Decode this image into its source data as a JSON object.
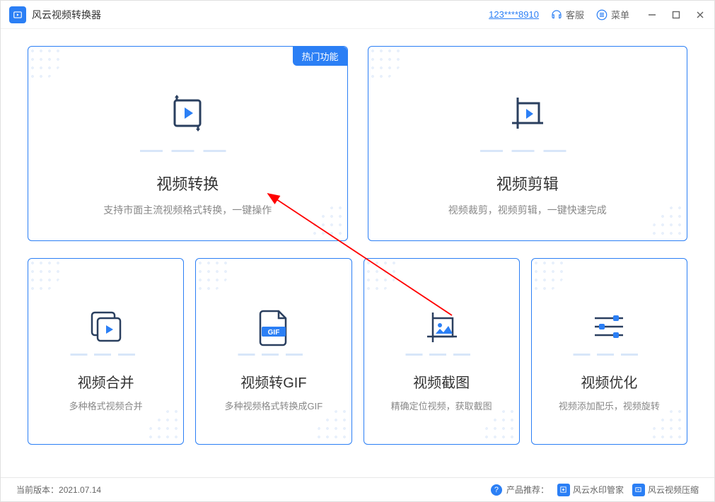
{
  "app": {
    "title": "风云视频转换器",
    "account_id": "123****8910",
    "service_label": "客服",
    "menu_label": "菜单"
  },
  "cards": {
    "top": [
      {
        "badge": "热门功能",
        "title": "视频转换",
        "desc": "支持市面主流视频格式转换，一键操作"
      },
      {
        "title": "视频剪辑",
        "desc": "视频裁剪，视频剪辑，一键快速完成"
      }
    ],
    "bottom": [
      {
        "title": "视频合并",
        "desc": "多种格式视频合并"
      },
      {
        "title": "视频转GIF",
        "desc": "多种视频格式转换成GIF",
        "gif_label": "GIF"
      },
      {
        "title": "视频截图",
        "desc": "精确定位视频，获取截图"
      },
      {
        "title": "视频优化",
        "desc": "视频添加配乐，视频旋转"
      }
    ]
  },
  "footer": {
    "version_label": "当前版本：",
    "version": "2021.07.14",
    "recommend_label": "产品推荐：",
    "products": [
      "风云水印管家",
      "风云视频压缩"
    ]
  }
}
